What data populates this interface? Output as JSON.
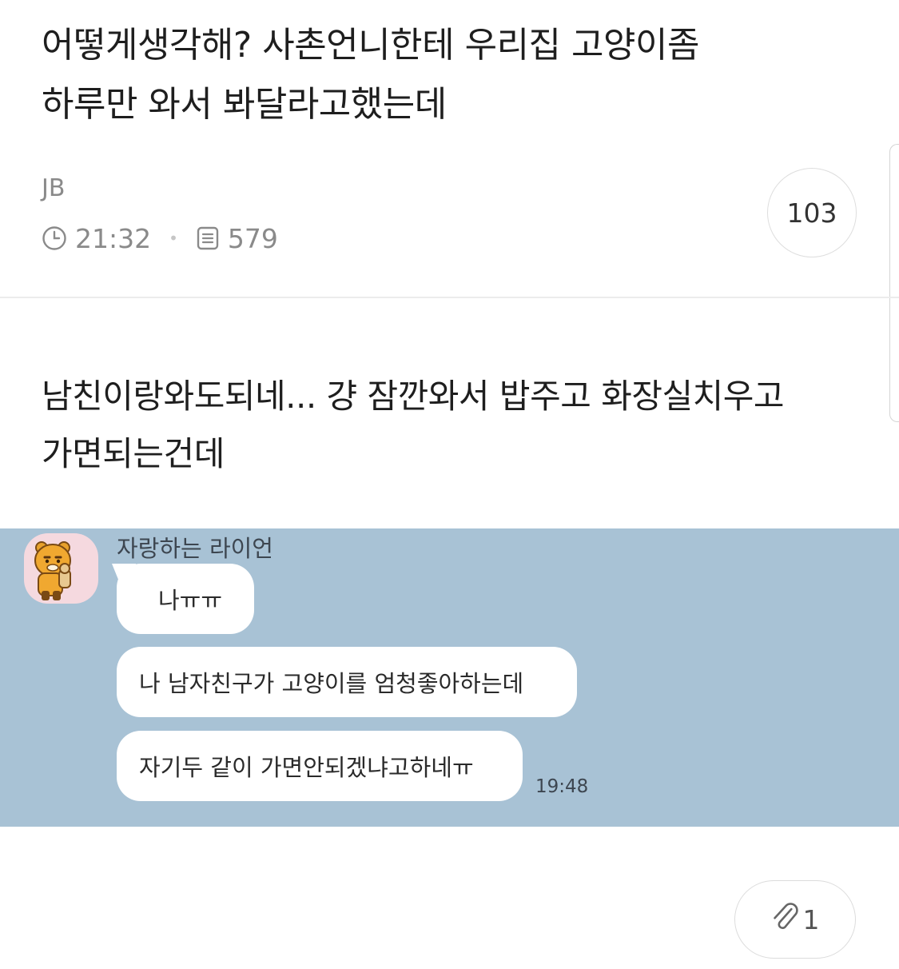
{
  "post": {
    "title_line1": "어떻게생각해? 사촌언니한테 우리집 고양이좀",
    "title_line2": "하루만 와서 봐달라고했는데",
    "author": "JB",
    "time": "21:32",
    "views": "579",
    "comment_count": "103",
    "body_line1": "남친이랑와도되네... 걍 잠깐와서 밥주고 화장실치우고",
    "body_line2": "가면되는건데",
    "attachment_count": "1"
  },
  "chat": {
    "sender_name": "자랑하는 라이언",
    "messages": [
      "나ㅠㅠ",
      "나 남자친구가 고양이를 엄청좋아하는데",
      "자기두 같이 가면안되겠냐고하네ㅠ"
    ],
    "time": "19:48",
    "background_color": "#a8c2d5"
  },
  "icons": {
    "time": "clock-icon",
    "views": "list-document-icon",
    "attachment": "paperclip-icon",
    "avatar": "ryan-character-avatar"
  }
}
